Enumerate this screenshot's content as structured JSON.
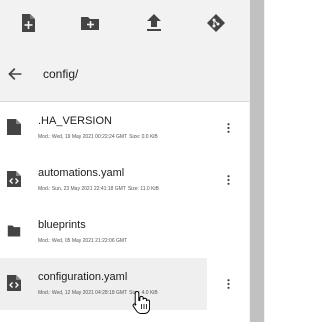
{
  "toolbar": {
    "buttons": [
      {
        "icon": "new-file-icon"
      },
      {
        "icon": "new-folder-icon"
      },
      {
        "icon": "upload-icon"
      },
      {
        "icon": "git-icon"
      }
    ]
  },
  "path": {
    "back_icon": "arrow-left-icon",
    "current": "config/"
  },
  "files": [
    {
      "name": ".HA_VERSION",
      "icon": "file-icon",
      "modified": "Mod.: Wed, 19 May 2021 00:22:24 GMT",
      "size": "Size: 0.0 KiB"
    },
    {
      "name": "automations.yaml",
      "icon": "code-file-icon",
      "modified": "Mod.: Sun, 23 May 2021 22:41:18 GMT",
      "size": "Size: 11.0 KiB"
    },
    {
      "name": "blueprints",
      "icon": "folder-icon",
      "modified": "Mod.: Wed, 05 May 2021 21:22:06 GMT",
      "size": ""
    },
    {
      "name": "configuration.yaml",
      "icon": "code-file-icon",
      "modified": "Mod.: Wed, 12 May 2021 04:28:18 GMT",
      "size": "Size: 4.0 KiB"
    }
  ],
  "colors": {
    "header_bg": "#f2f2f2",
    "icon_dark": "#444444",
    "hover_row": "#efefef",
    "scrollbar": "#c1c1c1"
  }
}
